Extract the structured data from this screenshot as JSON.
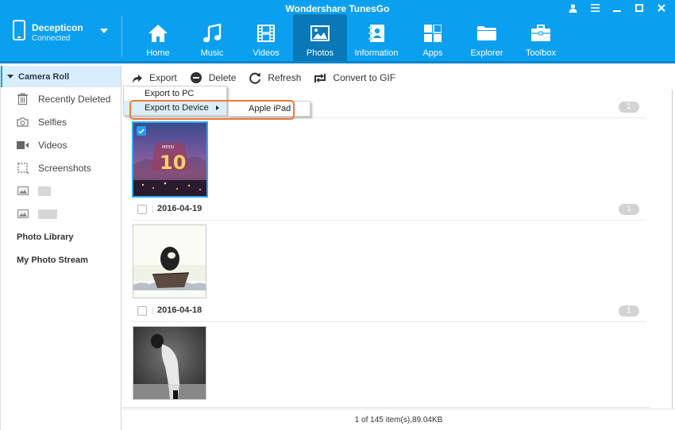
{
  "app": {
    "title": "Wondershare TunesGo"
  },
  "window_controls": [
    {
      "name": "account",
      "icon": "user-icon"
    },
    {
      "name": "menu",
      "icon": "hamburger-icon"
    },
    {
      "name": "minimize",
      "icon": "minimize-icon"
    },
    {
      "name": "maximize",
      "icon": "maximize-icon"
    },
    {
      "name": "close",
      "icon": "close-icon"
    }
  ],
  "device": {
    "name": "Decepticon",
    "status": "Connected"
  },
  "nav": {
    "active": "Photos",
    "items": [
      {
        "label": "Home",
        "icon": "home-icon"
      },
      {
        "label": "Music",
        "icon": "music-icon"
      },
      {
        "label": "Videos",
        "icon": "film-icon"
      },
      {
        "label": "Photos",
        "icon": "photo-icon"
      },
      {
        "label": "Information",
        "icon": "contacts-icon"
      },
      {
        "label": "Apps",
        "icon": "apps-icon"
      },
      {
        "label": "Explorer",
        "icon": "folder-icon"
      },
      {
        "label": "Toolbox",
        "icon": "toolbox-icon"
      }
    ]
  },
  "sidebar": {
    "header": "Camera Roll",
    "items": [
      {
        "label": "Recently Deleted",
        "icon": "trash-icon"
      },
      {
        "label": "Selfies",
        "icon": "selfie-camera-icon"
      },
      {
        "label": "Videos",
        "icon": "video-camera-icon"
      },
      {
        "label": "Screenshots",
        "icon": "screenshot-icon"
      },
      {
        "label": "",
        "icon": "album-icon",
        "blurred": true
      },
      {
        "label": "",
        "icon": "album-icon",
        "blurred": true
      }
    ],
    "sections": [
      "Photo Library",
      "My Photo Stream"
    ]
  },
  "toolbar": {
    "export": "Export",
    "delete": "Delete",
    "refresh": "Refresh",
    "convert_gif": "Convert to GIF"
  },
  "export_menu": {
    "items": [
      "Export to PC",
      "Export to Device"
    ],
    "hovered": "Export to Device",
    "submenu": [
      "Apple iPad"
    ]
  },
  "groups": [
    {
      "date": "",
      "count": "1",
      "checked": true,
      "thumb": "jersey-10-city-photo"
    },
    {
      "date": "2016-04-19",
      "count": "1",
      "checked": false,
      "thumb": "penguin-boat-cartoon"
    },
    {
      "date": "2016-04-18",
      "count": "1",
      "checked": false,
      "thumb": "football-player-bw-photo"
    }
  ],
  "status": {
    "text": "1 of 145 item(s),89.04KB"
  },
  "colors": {
    "accent": "#0ba0ef",
    "active_tab": "#0879b8",
    "highlight": "#f07a3a",
    "selected": "#29aaf0"
  }
}
